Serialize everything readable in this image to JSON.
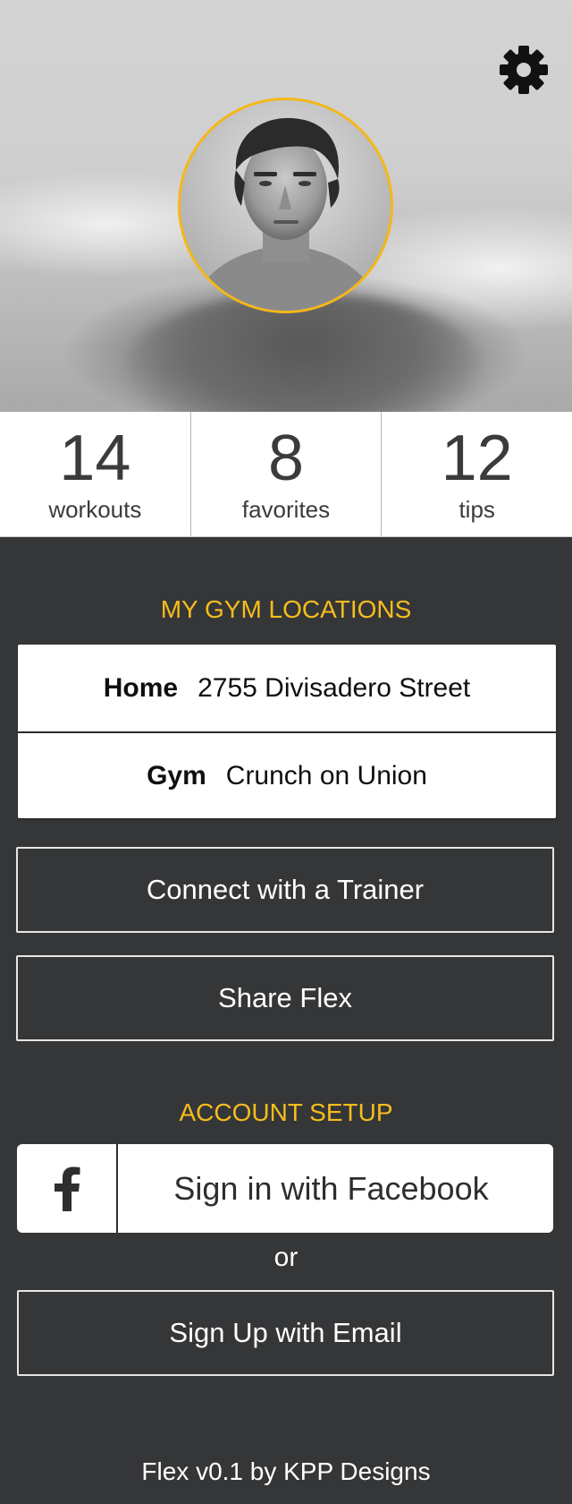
{
  "stats": [
    {
      "value": "14",
      "label": "workouts"
    },
    {
      "value": "8",
      "label": "favorites"
    },
    {
      "value": "12",
      "label": "tips"
    }
  ],
  "gym_locations": {
    "title": "MY GYM LOCATIONS",
    "items": [
      {
        "key": "Home",
        "value": "2755 Divisadero Street"
      },
      {
        "key": "Gym",
        "value": "Crunch on Union"
      }
    ]
  },
  "actions": {
    "connect_trainer": "Connect with a Trainer",
    "share": "Share Flex"
  },
  "account_setup": {
    "title": "ACCOUNT SETUP",
    "facebook_icon": "f",
    "facebook_label": "Sign in with Facebook",
    "or": "or",
    "email_label": "Sign Up with Email"
  },
  "footer": "Flex v0.1 by KPP Designs",
  "icons": {
    "settings": "gear-icon",
    "facebook": "facebook-icon",
    "profile": "profile-photo"
  },
  "colors": {
    "accent": "#f6bd1c",
    "background": "#353638",
    "avatar_ring": "#f5b717"
  }
}
